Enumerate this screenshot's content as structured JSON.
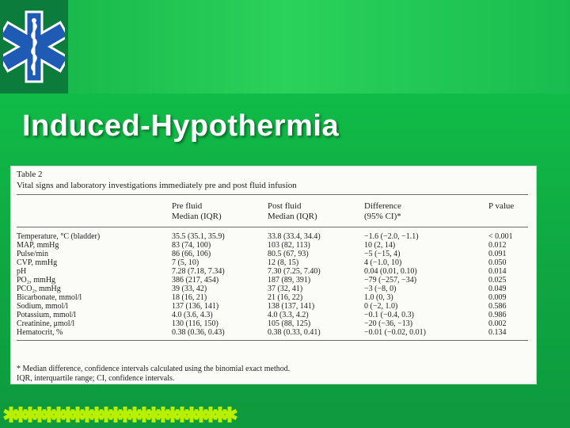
{
  "slide": {
    "title": "Induced-Hypothermia",
    "colors": {
      "background": "#11c74a",
      "logo_box": "#0c7c3c",
      "title": "#ffffff"
    },
    "logo_icon": "star-of-life-icon"
  },
  "table": {
    "caption_label": "Table 2",
    "caption_text": "Vital signs and laboratory investigations immediately pre and post fluid infusion",
    "headers": {
      "pre_line1": "Pre fluid",
      "pre_line2": "Median (IQR)",
      "post_line1": "Post fluid",
      "post_line2": "Median (IQR)",
      "diff_line1": "Difference",
      "diff_line2": "(95% CI)*",
      "p_value": "P value"
    },
    "rows": [
      {
        "label": "Temperature, °C (bladder)",
        "pre": "35.5 (35.1, 35.9)",
        "post": "33.8 (33.4, 34.4)",
        "diff": "−1.6 (−2.0, −1.1)",
        "p": "< 0.001"
      },
      {
        "label": "MAP, mmHg",
        "pre": "83 (74, 100)",
        "post": "103 (82, 113)",
        "diff": "10 (2, 14)",
        "p": "0.012"
      },
      {
        "label": "Pulse/min",
        "pre": "86 (66, 106)",
        "post": "80.5 (67, 93)",
        "diff": "−5 (−15, 4)",
        "p": "0.091"
      },
      {
        "label": "CVP, mmHg",
        "pre": "7 (5, 10)",
        "post": "12 (8, 15)",
        "diff": "4 (−1.0, 10)",
        "p": "0.050"
      },
      {
        "label": "pH",
        "pre": "7.28 (7.18, 7.34)",
        "post": "7.30 (7.25, 7.40)",
        "diff": "0.04 (0.01, 0.10)",
        "p": "0.014"
      },
      {
        "label": "PO₂, mmHg",
        "pre": "386 (217, 454)",
        "post": "187 (89, 391)",
        "diff": "−79 (−257, −34)",
        "p": "0.025"
      },
      {
        "label": "PCO₂, mmHg",
        "pre": "39 (33, 42)",
        "post": "37 (32, 41)",
        "diff": "−3 (−8, 0)",
        "p": "0.049"
      },
      {
        "label": "Bicarbonate, mmol/l",
        "pre": "18 (16, 21)",
        "post": "21 (16, 22)",
        "diff": "1.0 (0, 3)",
        "p": "0.009"
      },
      {
        "label": "Sodium, mmol/l",
        "pre": "137 (136, 141)",
        "post": "138 (137, 141)",
        "diff": "0 (−2, 1.0)",
        "p": "0.586"
      },
      {
        "label": "Potassium, mmol/l",
        "pre": "4.0 (3.6, 4.3)",
        "post": "4.0 (3.3, 4.2)",
        "diff": "−0.1 (−0.4, 0.3)",
        "p": "0.986"
      },
      {
        "label": "Creatinine, μmol/l",
        "pre": "130 (116, 150)",
        "post": "105 (88, 125)",
        "diff": "−20 (−36, −13)",
        "p": "0.002"
      },
      {
        "label": "Hematocrit, %",
        "pre": "0.38 (0.36, 0.43)",
        "post": "0.38 (0.33, 0.41)",
        "diff": "−0.01 (−0.02, 0.01)",
        "p": "0.134"
      }
    ],
    "footnote_line1": "* Median difference, confidence intervals calculated using the binomial exact method.",
    "footnote_line2": "IQR, interquartile range; CI, confidence intervals."
  },
  "border": {
    "motif_icon": "star-of-life-icon",
    "color": "#b8f000"
  }
}
